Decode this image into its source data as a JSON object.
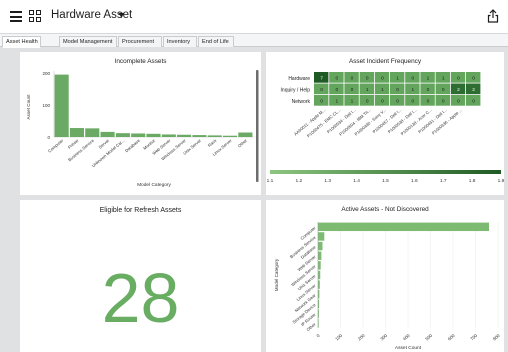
{
  "app": {
    "title": "Hardware Asset",
    "caret": "▼",
    "menu_icon": "hamburger-icon",
    "grid_icon": "grid-icon",
    "share_icon": "share-icon"
  },
  "tabs": [
    {
      "label": "Asset Health",
      "active": true
    },
    {
      "label": "Model Management",
      "active": false
    },
    {
      "label": "Procurement",
      "active": false
    },
    {
      "label": "Inventory",
      "active": false
    },
    {
      "label": "End of Life",
      "active": false
    }
  ],
  "colors": {
    "bar": "#6aaa64",
    "bar_light": "#7dba72",
    "heat_low": "#63a55d",
    "heat_high": "#1f5a24",
    "bignum": "#69ad63"
  },
  "incomplete_assets": {
    "title": "Incomplete Assets",
    "chart_data": {
      "type": "bar",
      "title": "Incomplete Assets",
      "xlabel": "Model Category",
      "ylabel": "Asset Count",
      "ylim": [
        0,
        200
      ],
      "yticks": [
        "200",
        "100",
        "0"
      ],
      "categories": [
        "Computer",
        "Printer",
        "Business Service",
        "Server",
        "Unknown Model Cat...",
        "Database",
        "Monitor",
        "Web Server",
        "Windows Server",
        "Unix Server",
        "Rack",
        "Linux Server",
        "Other"
      ],
      "values": [
        195,
        28,
        27,
        16,
        12,
        11,
        10,
        8,
        7,
        6,
        5,
        4,
        14
      ]
    }
  },
  "incident_frequency": {
    "title": "Asset Incident Frequency",
    "chart_data": {
      "type": "heatmap",
      "title": "Asset Incident Frequency",
      "rows": [
        "Hardware",
        "Inquiry / Help",
        "Network"
      ],
      "columns": [
        "AA60011 - Apple M...",
        "P1000475 - EMC CL...",
        "P1000534 - Dell I...",
        "P1000504 - IBM Th...",
        "P1000490 - Sony V...",
        "P1000457 - Dell I...",
        "P1000538 - Dell I...",
        "P1000138 - Acer C...",
        "P1000431 - Dell I...",
        "P1000636 - Apple ..."
      ],
      "values": [
        [
          7,
          0,
          0,
          0,
          0,
          1,
          0,
          1,
          1,
          0,
          0
        ],
        [
          0,
          0,
          0,
          1,
          1,
          0,
          1,
          0,
          0,
          2,
          2
        ],
        [
          0,
          1,
          1,
          0,
          0,
          0,
          0,
          0,
          0,
          0,
          0
        ]
      ],
      "color_scale_ticks": [
        "1.1",
        "1.2",
        "1.3",
        "1.4",
        "1.5",
        "1.6",
        "1.7",
        "1.8",
        "1.9"
      ]
    }
  },
  "refresh": {
    "title": "Eligible for Refresh Assets",
    "value": "28"
  },
  "not_discovered": {
    "title": "Active Assets - Not Discovered",
    "chart_data": {
      "type": "bar",
      "orientation": "horizontal",
      "title": "Active Assets - Not Discovered",
      "xlabel": "Asset Count",
      "ylabel": "Model Category",
      "xlim": [
        0,
        800
      ],
      "xticks": [
        "0",
        "100",
        "200",
        "300",
        "400",
        "500",
        "600",
        "700",
        "800"
      ],
      "categories": [
        "Computer",
        "Business Service",
        "Database",
        "Web Server",
        "Windows Server",
        "Unix Server",
        "Linux Server",
        "Network Gear",
        "Storage Device",
        "IP Router",
        "Other"
      ],
      "values": [
        760,
        28,
        20,
        15,
        12,
        10,
        8,
        6,
        5,
        4,
        3
      ]
    }
  }
}
